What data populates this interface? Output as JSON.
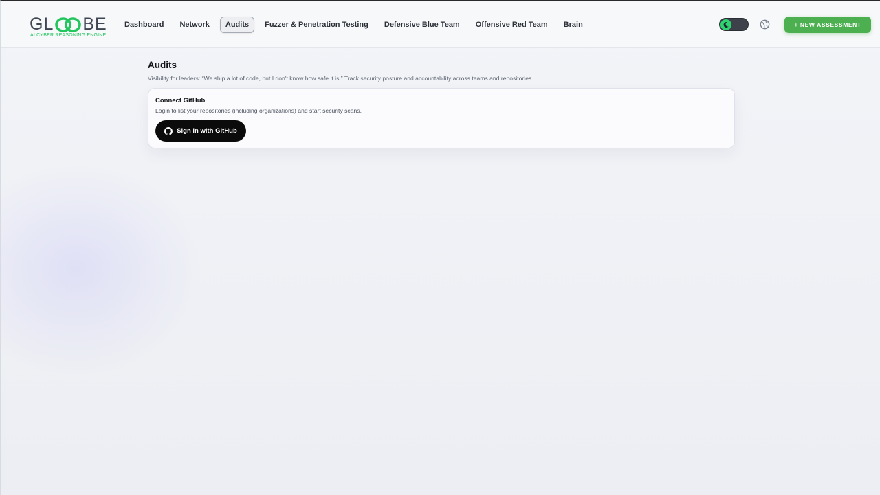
{
  "brand": {
    "name_left": "GL",
    "name_right": "BE",
    "tagline": "AI CYBER REASONING ENGINE",
    "accent_color": "#22c55e"
  },
  "nav": {
    "items": [
      {
        "label": "Dashboard",
        "active": false
      },
      {
        "label": "Network",
        "active": false
      },
      {
        "label": "Audits",
        "active": true
      },
      {
        "label": "Fuzzer & Penetration Testing",
        "active": false
      },
      {
        "label": "Defensive Blue Team",
        "active": false
      },
      {
        "label": "Offensive Red Team",
        "active": false
      },
      {
        "label": "Brain",
        "active": false
      }
    ]
  },
  "header_actions": {
    "theme_toggle_icon": "moon-icon",
    "language_icon": "globe-icon",
    "new_assessment_label": "+ NEW ASSESSMENT",
    "new_assessment_color": "#4caf50"
  },
  "main": {
    "title": "Audits",
    "subtitle": "Visibility for leaders: “We ship a lot of code, but I don't know how safe it is.” Track security posture and accountability across teams and repositories.",
    "connect_card": {
      "title": "Connect GitHub",
      "description": "Login to list your repositories (including organizations) and start security scans.",
      "button_label": "Sign in with GitHub",
      "button_icon": "github-icon"
    }
  }
}
